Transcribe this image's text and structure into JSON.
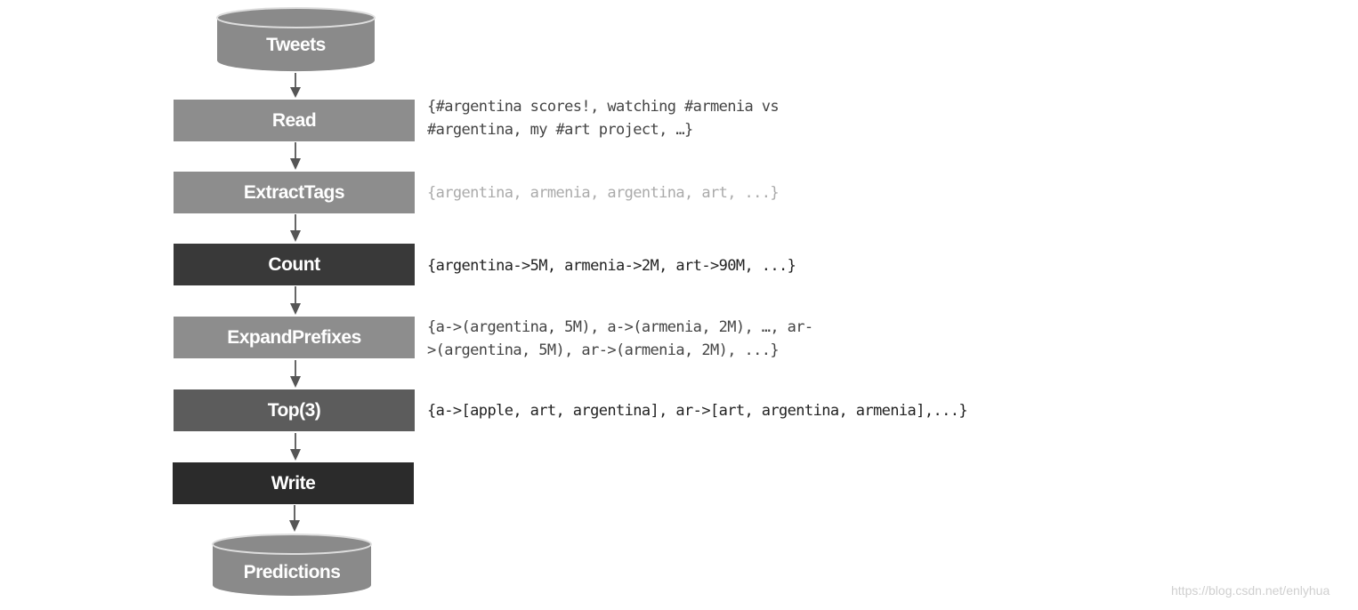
{
  "diagram": {
    "source": {
      "label": "Tweets",
      "shape": "cylinder"
    },
    "steps": [
      {
        "label": "Read",
        "note_lines": [
          "{#argentina scores!, watching #armenia vs",
          "#argentina, my #art project, …}"
        ]
      },
      {
        "label": "ExtractTags",
        "note_lines": [
          "{argentina, armenia, argentina, art, ...}"
        ]
      },
      {
        "label": "Count",
        "note_lines": [
          "{argentina->5M, armenia->2M, art->90M, ...}"
        ]
      },
      {
        "label": "ExpandPrefixes",
        "note_lines": [
          "{a->(argentina, 5M), a->(armenia, 2M), …, ar-",
          ">(argentina, 5M), ar->(armenia, 2M), ...}"
        ]
      },
      {
        "label": "Top(3)",
        "note_lines": [
          "{a->[apple, art, argentina], ar->[art, argentina, armenia],...}"
        ]
      },
      {
        "label": "Write",
        "note_lines": []
      }
    ],
    "sink": {
      "label": "Predictions",
      "shape": "cylinder"
    }
  },
  "colors": {
    "light_step": "#8d8d8d",
    "mid_step": "#5c5c5c",
    "dark_step": "#393939",
    "darker_step": "#2b2b2b",
    "cylinder": "#8a8a8a"
  },
  "watermark": "https://blog.csdn.net/enlyhua"
}
